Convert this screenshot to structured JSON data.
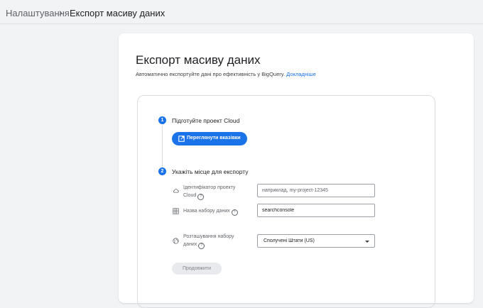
{
  "breadcrumb": {
    "root": "Налаштування",
    "separator": "›",
    "current": "Експорт масиву даних"
  },
  "page": {
    "title": "Експорт масиву даних",
    "subtitle": "Автоматично експортуйте дані про ефективність у BigQuery.",
    "learn_more": "Докладніше"
  },
  "steps": [
    {
      "number": "1",
      "title": "Підготуйте проект Cloud",
      "button_label": "Переглянути вказівки",
      "button_icon": "open-in-new-icon"
    },
    {
      "number": "2",
      "title": "Укажіть місце для експорту",
      "fields": {
        "project_id": {
          "icon": "cloud-icon",
          "label_line1": "Ідентифікатор проекту",
          "label_line2": "Cloud",
          "placeholder": "наприклад, my-project-12345",
          "value": ""
        },
        "dataset_name": {
          "icon": "table-icon",
          "label": "Назва набору даних",
          "value": "searchconsole"
        },
        "dataset_location": {
          "icon": "globe-icon",
          "label_line1": "Розташування набору",
          "label_line2": "даних",
          "value": "Сполучені Штати (US)"
        }
      },
      "help_glyph": "?",
      "continue_label": "Продовжити"
    }
  ],
  "colors": {
    "accent": "#1a73e8",
    "background": "#f1f3f4",
    "card": "#ffffff",
    "disabled_bg": "#e8eaed"
  }
}
